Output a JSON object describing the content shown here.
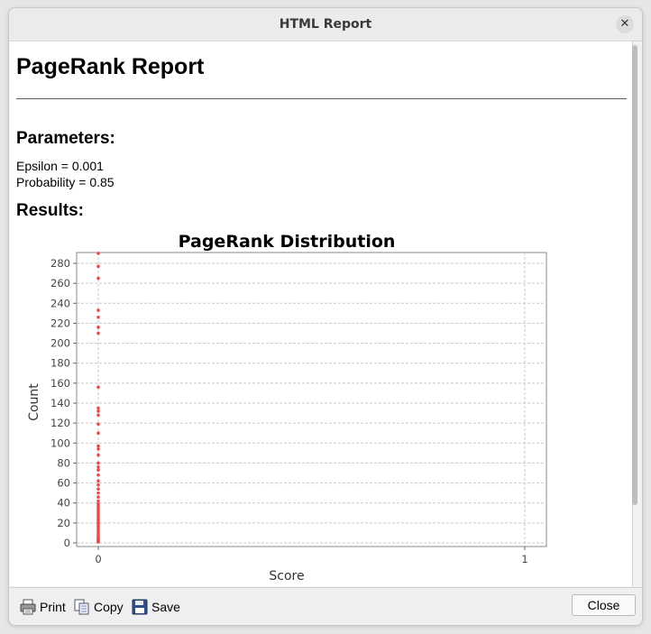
{
  "window": {
    "title": "HTML Report"
  },
  "report": {
    "heading": "PageRank Report",
    "parameters_heading": "Parameters:",
    "parameters": [
      "Epsilon = 0.001",
      "Probability = 0.85"
    ],
    "results_heading": "Results:"
  },
  "chart_data": {
    "type": "scatter",
    "title": "PageRank Distribution",
    "xlabel": "Score",
    "ylabel": "Count",
    "xlim": [
      0,
      1
    ],
    "ylim": [
      0,
      290
    ],
    "xticks": [
      "0",
      "1"
    ],
    "yticks": [
      0,
      20,
      40,
      60,
      80,
      100,
      120,
      140,
      160,
      180,
      200,
      220,
      240,
      260,
      280
    ],
    "grid": true,
    "marker_color": "#e8494a",
    "series": [
      {
        "points": [
          [
            0,
            290
          ],
          [
            0,
            277
          ],
          [
            0,
            265
          ],
          [
            0,
            233
          ],
          [
            0,
            226
          ],
          [
            0,
            216
          ],
          [
            0,
            210
          ],
          [
            0,
            156
          ],
          [
            0,
            135
          ],
          [
            0,
            132
          ],
          [
            0,
            128
          ],
          [
            0,
            119
          ],
          [
            0,
            110
          ],
          [
            0,
            97
          ],
          [
            0,
            94
          ],
          [
            0,
            88
          ],
          [
            0,
            80
          ],
          [
            0,
            76
          ],
          [
            0,
            73
          ],
          [
            0,
            68
          ],
          [
            0,
            62
          ],
          [
            0,
            58
          ],
          [
            0,
            54
          ],
          [
            0,
            50
          ],
          [
            0,
            46
          ],
          [
            0,
            42
          ],
          [
            0,
            39
          ],
          [
            0,
            37
          ],
          [
            0,
            35
          ],
          [
            0,
            33
          ],
          [
            0,
            31
          ],
          [
            0,
            29
          ],
          [
            0,
            27
          ],
          [
            0,
            25
          ],
          [
            0,
            23
          ],
          [
            0,
            21
          ],
          [
            0,
            19
          ],
          [
            0,
            17
          ],
          [
            0,
            15
          ],
          [
            0,
            13
          ],
          [
            0,
            11
          ],
          [
            0,
            9
          ],
          [
            0,
            7
          ],
          [
            0,
            5
          ],
          [
            0,
            4
          ],
          [
            0,
            3
          ],
          [
            0,
            2
          ],
          [
            0,
            1
          ]
        ]
      }
    ]
  },
  "footer": {
    "print_label": "Print",
    "copy_label": "Copy",
    "save_label": "Save",
    "close_label": "Close"
  },
  "icons": {
    "print": "printer-icon",
    "copy": "copy-icon",
    "save": "floppy-disk-icon",
    "close": "close-icon"
  }
}
